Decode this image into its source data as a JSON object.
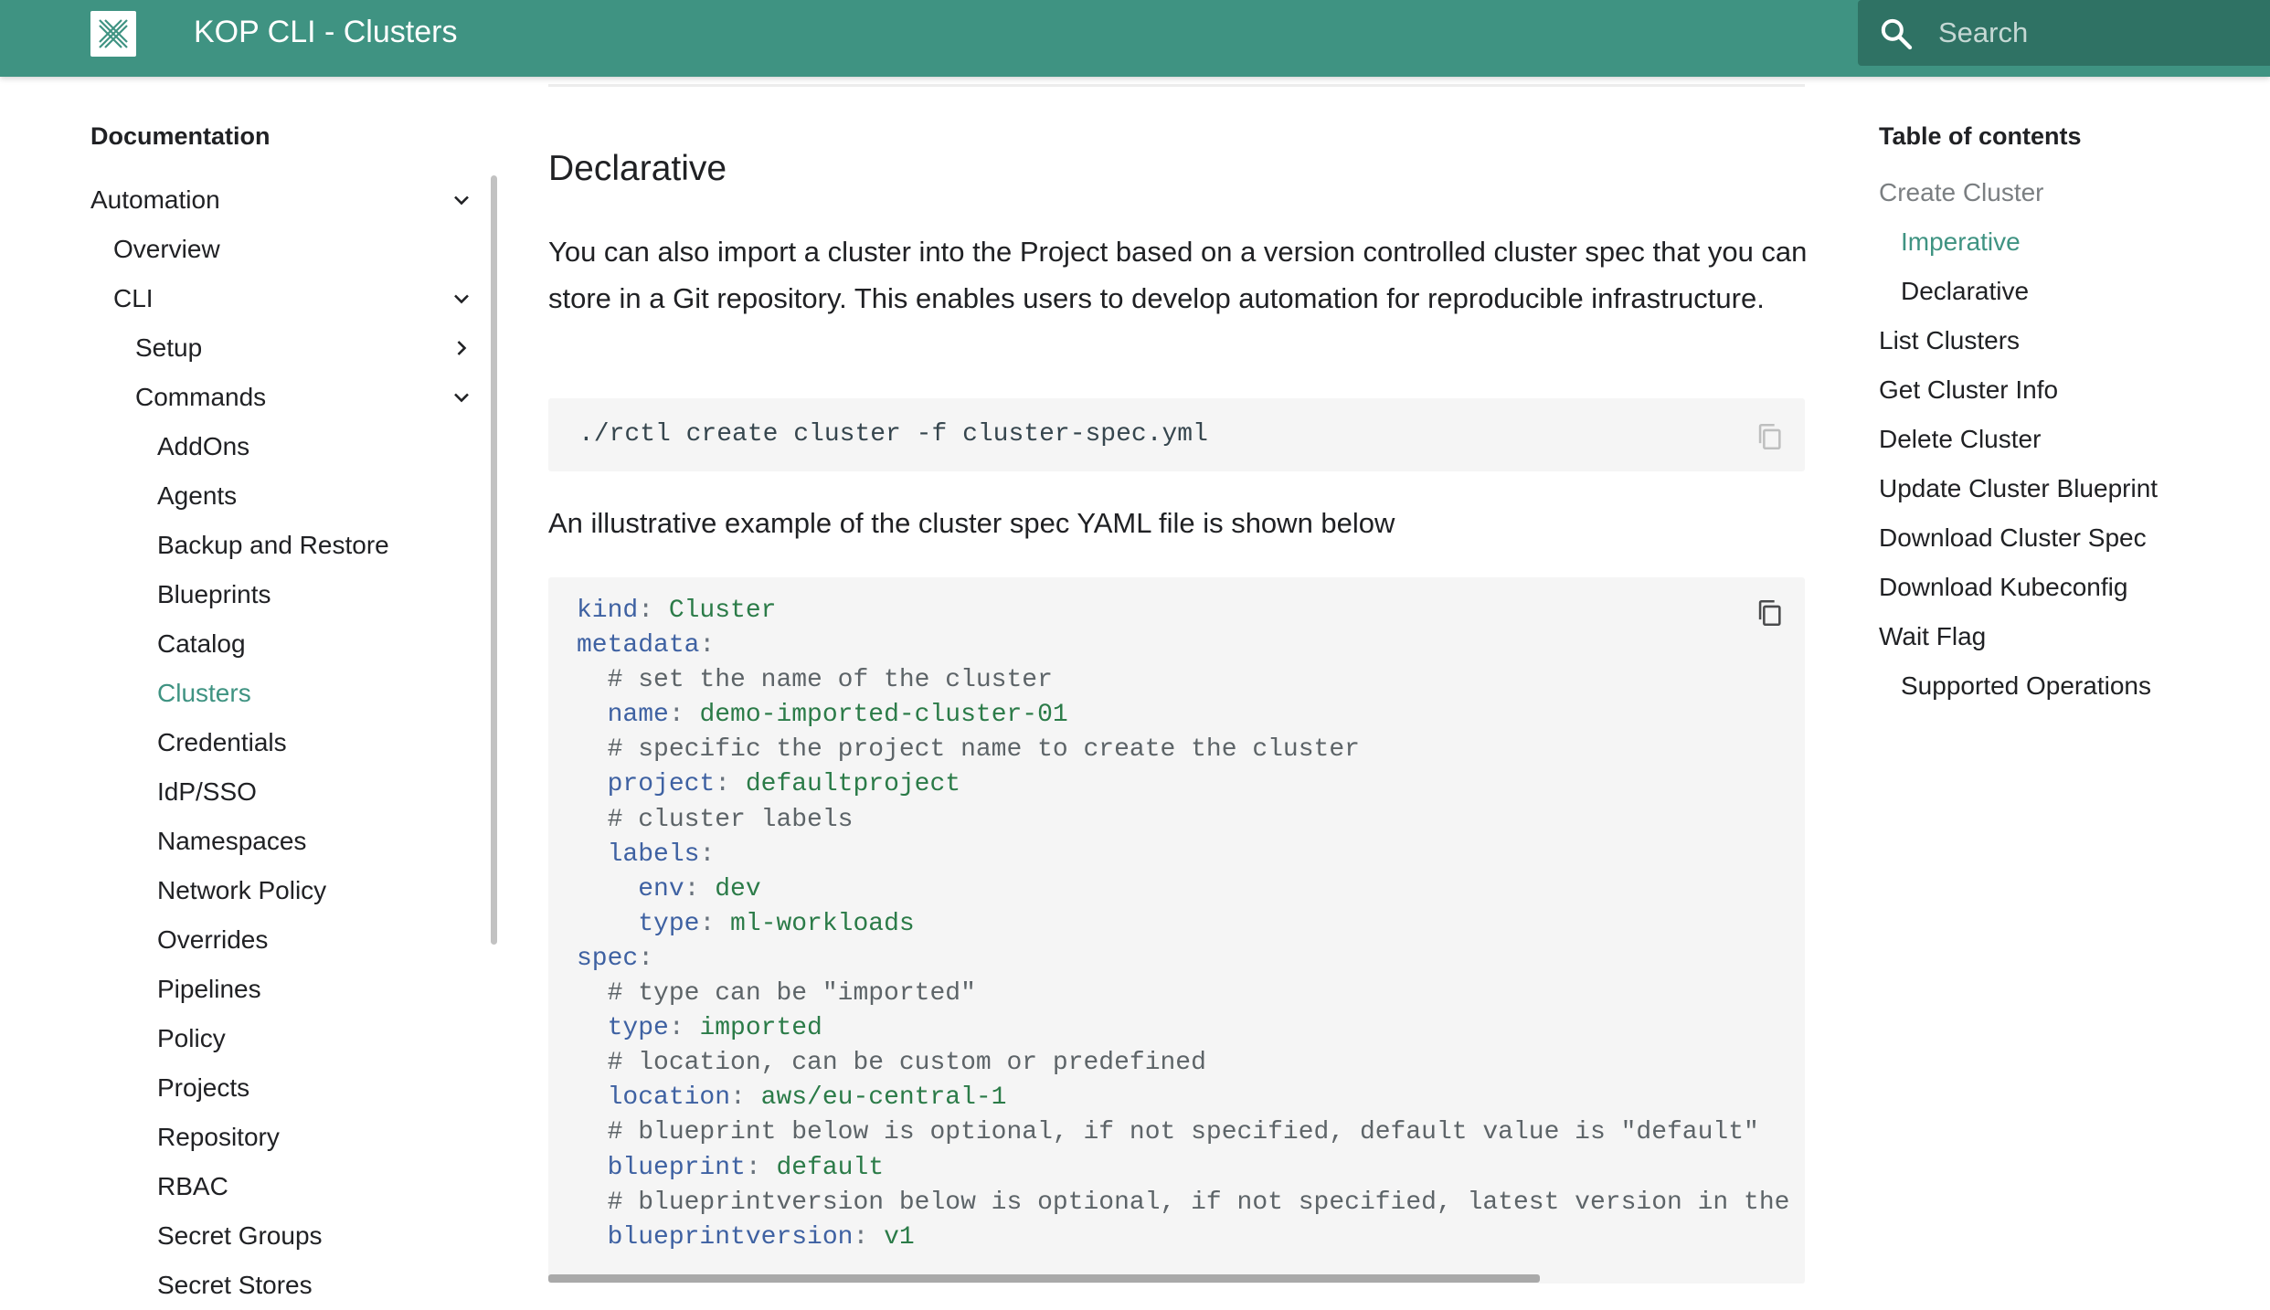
{
  "header": {
    "title": "KOP CLI - Clusters",
    "search_placeholder": "Search",
    "colors": {
      "primary": "#3f9382",
      "search_bg": "#2f7264"
    }
  },
  "nav": {
    "heading": "Documentation",
    "items": [
      {
        "label": "Automation",
        "expanded": true
      },
      {
        "label": "Overview"
      },
      {
        "label": "CLI",
        "expanded": true
      },
      {
        "label": "Setup",
        "expanded": false
      },
      {
        "label": "Commands",
        "expanded": true
      },
      {
        "label": "AddOns"
      },
      {
        "label": "Agents"
      },
      {
        "label": "Backup and Restore"
      },
      {
        "label": "Blueprints"
      },
      {
        "label": "Catalog"
      },
      {
        "label": "Clusters",
        "active": true
      },
      {
        "label": "Credentials"
      },
      {
        "label": "IdP/SSO"
      },
      {
        "label": "Namespaces"
      },
      {
        "label": "Network Policy"
      },
      {
        "label": "Overrides"
      },
      {
        "label": "Pipelines"
      },
      {
        "label": "Policy"
      },
      {
        "label": "Projects"
      },
      {
        "label": "Repository"
      },
      {
        "label": "RBAC"
      },
      {
        "label": "Secret Groups"
      },
      {
        "label": "Secret Stores"
      }
    ]
  },
  "main": {
    "heading": "Declarative",
    "paragraph": "You can also import a cluster into the Project based on a version controlled cluster spec that you can store in a Git repository. This enables users to develop automation for reproducible infrastructure.",
    "command": "./rctl create cluster -f cluster-spec.yml",
    "example_intro": "An illustrative example of the cluster spec YAML file is shown below",
    "yaml": {
      "l1_key": "kind",
      "l1_val": "Cluster",
      "l2_key": "metadata",
      "l3_comment": "# set the name of the cluster",
      "l4_key": "name",
      "l4_val": "demo-imported-cluster-01",
      "l5_comment": "# specific the project name to create the cluster",
      "l6_key": "project",
      "l6_val": "defaultproject",
      "l7_comment": "# cluster labels",
      "l8_key": "labels",
      "l9_key": "env",
      "l9_val": "dev",
      "l10_key": "type",
      "l10_val": "ml-workloads",
      "l11_key": "spec",
      "l12_comment": "# type can be \"imported\"",
      "l13_key": "type",
      "l13_val": "imported",
      "l14_comment": "# location, can be custom or predefined",
      "l15_key": "location",
      "l15_val": "aws/eu-central-1",
      "l16_comment": "# blueprint below is optional, if not specified, default value is \"default\"",
      "l17_key": "blueprint",
      "l17_val": "default",
      "l18_comment": "# blueprintversion below is optional, if not specified, latest version in the blu",
      "l19_key": "blueprintversion",
      "l19_val": "v1"
    }
  },
  "toc": {
    "heading": "Table of contents",
    "items": [
      {
        "label": "Create Cluster",
        "level": 0,
        "state": "muted"
      },
      {
        "label": "Imperative",
        "level": 1,
        "state": "active"
      },
      {
        "label": "Declarative",
        "level": 1
      },
      {
        "label": "List Clusters",
        "level": 0
      },
      {
        "label": "Get Cluster Info",
        "level": 0
      },
      {
        "label": "Delete Cluster",
        "level": 0
      },
      {
        "label": "Update Cluster Blueprint",
        "level": 0
      },
      {
        "label": "Download Cluster Spec",
        "level": 0
      },
      {
        "label": "Download Kubeconfig",
        "level": 0
      },
      {
        "label": "Wait Flag",
        "level": 0
      },
      {
        "label": "Supported Operations",
        "level": 1
      }
    ]
  }
}
